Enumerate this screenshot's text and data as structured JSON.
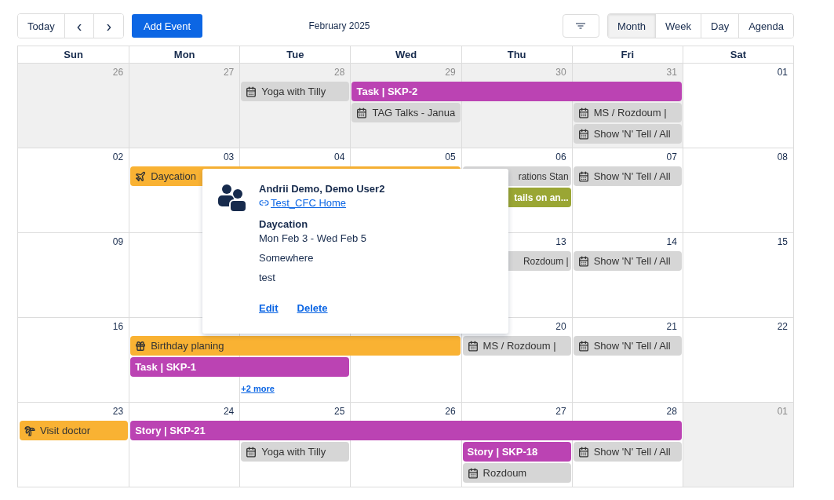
{
  "toolbar": {
    "today": "Today",
    "prev": "‹",
    "next": "›",
    "add": "Add Event",
    "title": "February 2025",
    "views": [
      {
        "label": "Month",
        "selected": true
      },
      {
        "label": "Week",
        "selected": false
      },
      {
        "label": "Day",
        "selected": false
      },
      {
        "label": "Agenda",
        "selected": false
      }
    ]
  },
  "weekdays": [
    "Sun",
    "Mon",
    "Tue",
    "Wed",
    "Thu",
    "Fri",
    "Sat"
  ],
  "weeks": [
    {
      "days": [
        {
          "number": "26",
          "outside": true
        },
        {
          "number": "27",
          "outside": true
        },
        {
          "number": "28",
          "outside": true
        },
        {
          "number": "29",
          "outside": true
        },
        {
          "number": "30",
          "outside": true
        },
        {
          "number": "31",
          "outside": true
        },
        {
          "number": "01",
          "outside": false
        }
      ],
      "lanes": [
        [
          {
            "kind": "empty"
          },
          {
            "kind": "empty"
          },
          {
            "text": "Yoga with Tilly",
            "kind": "meeting",
            "color": "#d6d6d6"
          },
          {
            "text": "Task | SKP-2",
            "kind": "task",
            "color": "#bb43b3"
          },
          {
            "kind": "continued"
          },
          {
            "kind": "continued"
          },
          {
            "kind": "empty"
          }
        ],
        [
          {
            "kind": "empty"
          },
          {
            "kind": "empty"
          },
          {
            "kind": "empty"
          },
          {
            "text": "TAG Talks - Janua",
            "kind": "meeting",
            "color": "#d6d6d6"
          },
          {
            "kind": "empty"
          },
          {
            "text": "MS / Rozdoum |",
            "kind": "meeting",
            "color": "#d6d6d6"
          },
          {
            "kind": "empty"
          }
        ],
        [
          {
            "kind": "empty"
          },
          {
            "kind": "empty"
          },
          {
            "kind": "empty"
          },
          {
            "kind": "empty"
          },
          {
            "kind": "empty"
          },
          {
            "text": "Show 'N' Tell / All",
            "kind": "meeting",
            "color": "#d6d6d6"
          },
          {
            "kind": "empty"
          }
        ]
      ]
    },
    {
      "days": [
        {
          "number": "02",
          "outside": false
        },
        {
          "number": "03",
          "outside": false
        },
        {
          "number": "04",
          "outside": false
        },
        {
          "number": "05",
          "outside": false
        },
        {
          "number": "06",
          "outside": false
        },
        {
          "number": "07",
          "outside": false
        },
        {
          "number": "08",
          "outside": false
        }
      ],
      "lanes": [
        [
          {
            "kind": "empty"
          },
          {
            "text": "Daycation",
            "kind": "plane",
            "color": "#f9b233"
          },
          {
            "kind": "continued"
          },
          {
            "kind": "continued"
          },
          {
            "text": "rations Stan",
            "kind": "meeting",
            "color": "#d6d6d6",
            "cut_start": true
          },
          {
            "text": "Show 'N' Tell / All",
            "kind": "meeting",
            "color": "#d6d6d6"
          },
          {
            "kind": "empty"
          }
        ],
        [
          {
            "kind": "empty"
          },
          {
            "kind": "empty"
          },
          {
            "kind": "empty"
          },
          {
            "kind": "empty"
          },
          {
            "text": "tails on an...",
            "kind": "note",
            "color": "#9aa634",
            "cut_start": true
          },
          {
            "kind": "empty"
          },
          {
            "kind": "empty"
          }
        ]
      ]
    },
    {
      "days": [
        {
          "number": "09",
          "outside": false
        },
        {
          "outside": false
        },
        {
          "kind": "empty"
        },
        {
          "kind": "empty"
        },
        {
          "number": "13",
          "outside": false
        },
        {
          "number": "14",
          "outside": false
        },
        {
          "number": "15",
          "outside": false
        }
      ],
      "lanes": [
        [
          {
            "kind": "empty"
          },
          {
            "kind": "empty"
          },
          {
            "kind": "empty"
          },
          {
            "kind": "empty"
          },
          {
            "text": "Rozdoum |",
            "kind": "meeting",
            "color": "#d6d6d6",
            "cut_start": true
          },
          {
            "text": "Show 'N' Tell / All",
            "kind": "meeting",
            "color": "#d6d6d6"
          },
          {
            "kind": "empty"
          }
        ]
      ]
    },
    {
      "days": [
        {
          "number": "16",
          "outside": false
        },
        {
          "outside": false
        },
        {
          "outside": false
        },
        {
          "outside": false
        },
        {
          "number": "20",
          "outside": false
        },
        {
          "number": "21",
          "outside": false
        },
        {
          "number": "22",
          "outside": false
        }
      ],
      "lanes": [
        [
          {
            "kind": "empty"
          },
          {
            "text": "Birthday planing",
            "kind": "gift",
            "color": "#f9b233"
          },
          {
            "kind": "continued"
          },
          {
            "kind": "continued"
          },
          {
            "text": "MS / Rozdoum |",
            "kind": "meeting",
            "color": "#d6d6d6"
          },
          {
            "text": "Show 'N' Tell / All",
            "kind": "meeting",
            "color": "#d6d6d6"
          },
          {
            "kind": "empty"
          }
        ],
        [
          {
            "kind": "empty"
          },
          {
            "text": "Task | SKP-1",
            "kind": "task",
            "color": "#bb43b3"
          },
          {
            "kind": "continued"
          },
          {
            "kind": "empty"
          },
          {
            "kind": "empty"
          },
          {
            "kind": "empty"
          },
          {
            "kind": "empty"
          }
        ],
        [
          {
            "kind": "empty"
          },
          {
            "kind": "empty"
          },
          {
            "text": "+2 more",
            "kind": "more"
          },
          {
            "kind": "empty"
          },
          {
            "kind": "empty"
          },
          {
            "kind": "empty"
          },
          {
            "kind": "empty"
          }
        ]
      ]
    },
    {
      "days": [
        {
          "number": "23",
          "outside": false
        },
        {
          "number": "24",
          "outside": false
        },
        {
          "number": "25",
          "outside": false
        },
        {
          "number": "26",
          "outside": false
        },
        {
          "number": "27",
          "outside": false
        },
        {
          "number": "28",
          "outside": false
        },
        {
          "number": "01",
          "outside": true
        }
      ],
      "lanes": [
        [
          {
            "text": "Visit doctor",
            "kind": "palm",
            "color": "#f9b233"
          },
          {
            "text": "Story | SKP-21",
            "kind": "task",
            "color": "#bb43b3"
          },
          {
            "kind": "continued"
          },
          {
            "kind": "continued"
          },
          {
            "kind": "continued"
          },
          {
            "kind": "continued"
          },
          {
            "kind": "empty"
          }
        ],
        [
          {
            "kind": "empty"
          },
          {
            "kind": "empty"
          },
          {
            "text": "Yoga with Tilly",
            "kind": "meeting",
            "color": "#d6d6d6"
          },
          {
            "kind": "empty"
          },
          {
            "text": "Story | SKP-18",
            "kind": "task",
            "color": "#bb43b3"
          },
          {
            "text": "Show 'N' Tell / All",
            "kind": "meeting",
            "color": "#d6d6d6"
          },
          {
            "kind": "empty"
          }
        ],
        [
          {
            "kind": "empty"
          },
          {
            "kind": "empty"
          },
          {
            "kind": "empty"
          },
          {
            "kind": "empty"
          },
          {
            "text": "Rozdoum",
            "kind": "meeting",
            "color": "#d6d6d6"
          },
          {
            "kind": "empty"
          },
          {
            "kind": "empty"
          }
        ]
      ]
    }
  ],
  "popover": {
    "attendees": "Andrii Demo, Demo User2",
    "link": "Test_CFC Home",
    "title": "Daycation",
    "dates": "Mon Feb 3 - Wed Feb 5",
    "location": "Somewhere",
    "description": "test",
    "actions": [
      "Edit",
      "Delete"
    ]
  }
}
